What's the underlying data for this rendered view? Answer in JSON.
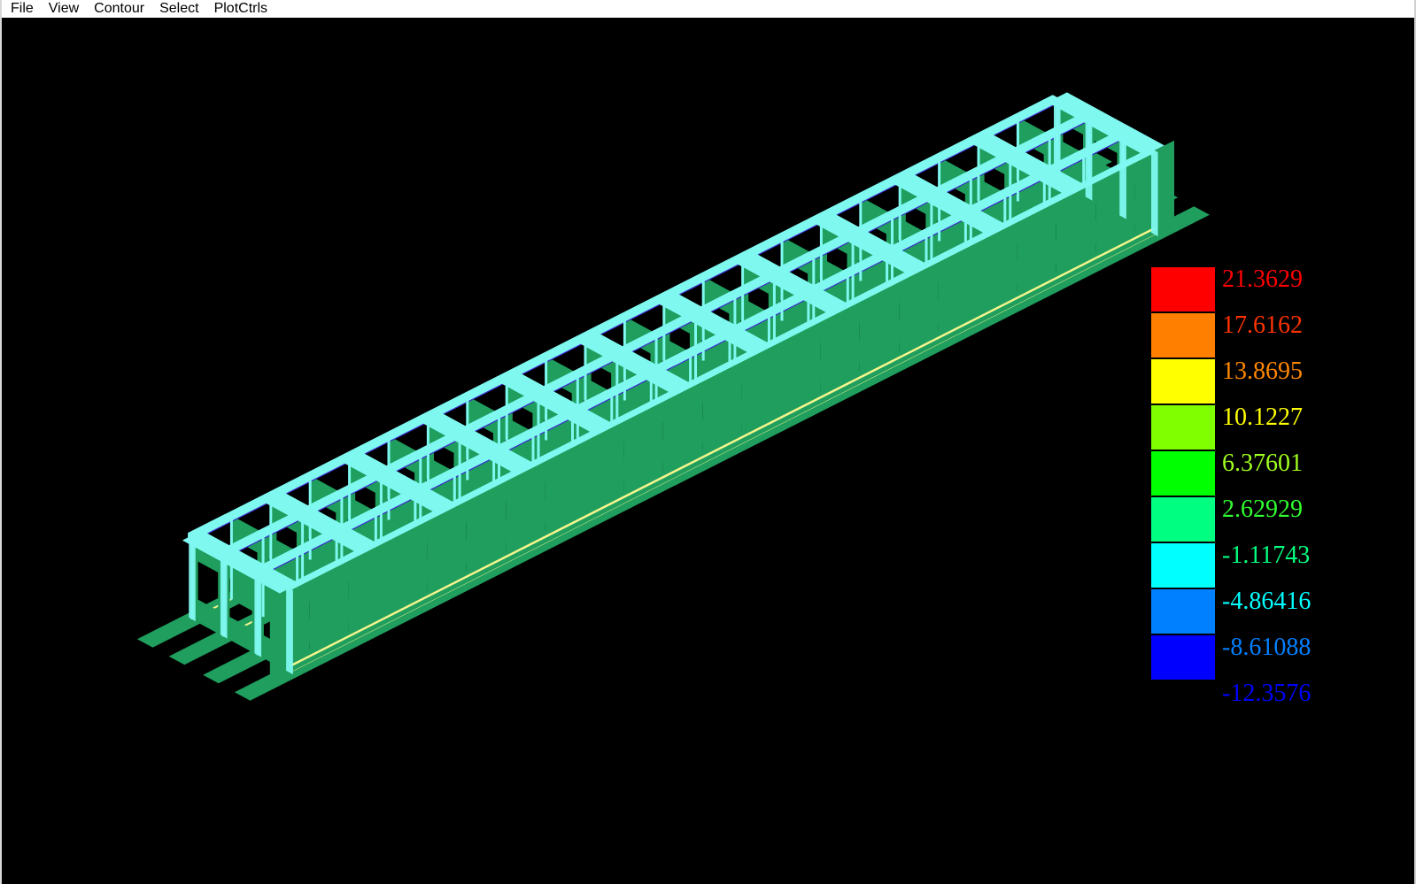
{
  "menu": {
    "items": [
      {
        "label": "File"
      },
      {
        "label": "View"
      },
      {
        "label": "Contour"
      },
      {
        "label": "Select"
      },
      {
        "label": "PlotCtrls"
      }
    ]
  },
  "legend": {
    "colors": [
      "#ff0000",
      "#ff7f00",
      "#ffff00",
      "#80ff00",
      "#00ff00",
      "#00ff80",
      "#00ffff",
      "#0080ff",
      "#0000ff"
    ],
    "labels": [
      {
        "text": "21.3629",
        "color": "#ff0000"
      },
      {
        "text": "17.6162",
        "color": "#ff3300"
      },
      {
        "text": "13.8695",
        "color": "#ff8800"
      },
      {
        "text": "10.1227",
        "color": "#ffff00"
      },
      {
        "text": "6.37601",
        "color": "#a0ff20"
      },
      {
        "text": "2.62929",
        "color": "#30ff30"
      },
      {
        "text": "-1.11743",
        "color": "#00ff80"
      },
      {
        "text": "-4.86416",
        "color": "#00ffff"
      },
      {
        "text": "-8.61088",
        "color": "#0080ff"
      },
      {
        "text": "-12.3576",
        "color": "#0000ff"
      }
    ]
  },
  "model": {
    "plate_color": "#1f9e5e",
    "top_color": "#7ff8f0",
    "accent_color": "#f5f58c",
    "edge_color": "#3c2bd0"
  }
}
